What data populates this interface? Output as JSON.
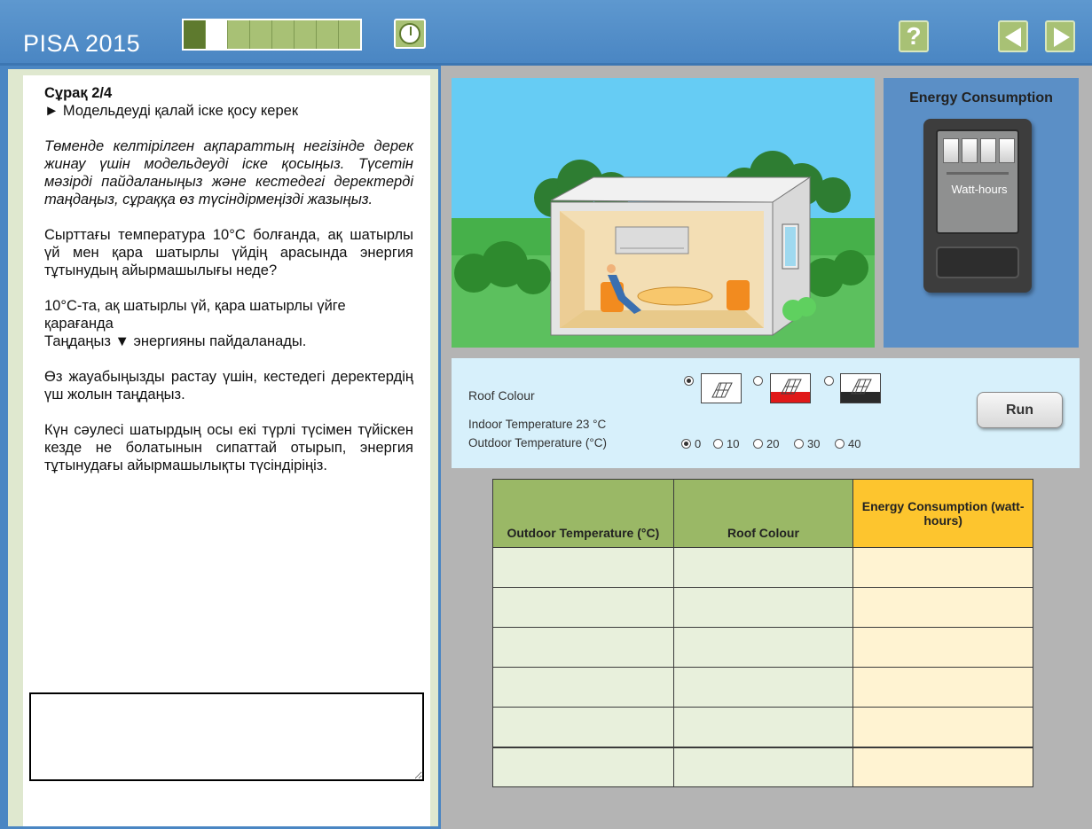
{
  "header": {
    "brand": "PISA 2015",
    "progress": {
      "total": 8,
      "completed": 1,
      "current": 2
    },
    "help_label": "?"
  },
  "question": {
    "title": "Сұрақ 2/4",
    "subtitle": "► Модельдеуді қалай іске қосу керек",
    "instruction": "Төменде келтірілген ақпараттың негізінде дерек жинау үшін модельдеуді іске қосыңыз. Түсетін мәзірді пайдаланыңыз және кестедегі деректерді таңдаңыз, сұраққа өз түсіндірмеңізді жазыңыз.",
    "prompt": "Сырттағы температура 10°С болғанда, ақ шатырлы үй мен қара шатырлы үйдің арасында энергия тұтынудың айырмашылығы неде?",
    "statement_1": "10°С-та, ақ шатырлы үй, қара шатырлы үйге қарағанда",
    "statement_2": "Таңдаңыз ▼ энергияны пайдаланады.",
    "support": "Өз жауабыңызды растау үшін, кестедегі деректердің үш жолын таңдаңыз.",
    "explain": "Күн сәулесі шатырдың осы екі түрлі түсімен түйіскен кезде не болатынын сипаттай отырып, энергия тұтынудағы айырмашылықты түсіндіріңіз.",
    "answer_value": ""
  },
  "energy_panel": {
    "title": "Energy Consumption",
    "unit": "Watt-hours"
  },
  "controls": {
    "roof_label": "Roof Colour",
    "roof_options": [
      "white",
      "red",
      "black"
    ],
    "roof_selected": "white",
    "indoor_label": "Indoor Temperature 23 °C",
    "outdoor_label": "Outdoor Temperature (°C)",
    "temp_options": [
      "0",
      "10",
      "20",
      "30",
      "40"
    ],
    "temp_selected": "0",
    "run_label": "Run"
  },
  "table": {
    "headers": [
      "Outdoor Temperature (°C)",
      "Roof Colour",
      "Energy Consumption (watt-hours)"
    ],
    "rows": [
      [
        "",
        "",
        ""
      ],
      [
        "",
        "",
        ""
      ],
      [
        "",
        "",
        ""
      ],
      [
        "",
        "",
        ""
      ],
      [
        "",
        "",
        ""
      ],
      [
        "",
        "",
        ""
      ]
    ]
  },
  "colors": {
    "header_blue": "#4a86c3",
    "progress_green": "#a8c175",
    "table_green": "#9ab866",
    "table_yellow": "#fdc52e"
  }
}
